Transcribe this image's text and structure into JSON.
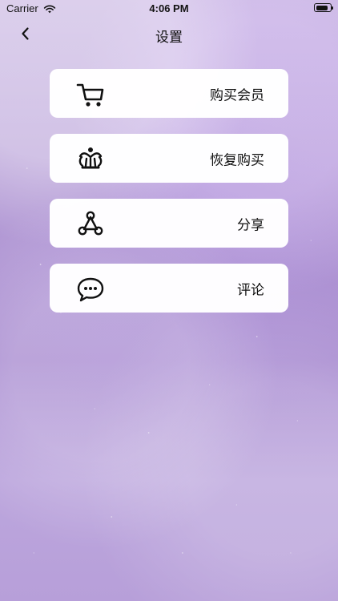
{
  "status_bar": {
    "carrier": "Carrier",
    "time": "4:06 PM",
    "battery_level": 0.9
  },
  "nav": {
    "title": "设置",
    "back_icon": "chevron-left-icon"
  },
  "menu": {
    "items": [
      {
        "label": "购买会员",
        "icon": "shopping-cart-icon"
      },
      {
        "label": "恢复购买",
        "icon": "crown-icon"
      },
      {
        "label": "分享",
        "icon": "share-network-icon"
      },
      {
        "label": "评论",
        "icon": "chat-bubble-icon"
      }
    ]
  }
}
